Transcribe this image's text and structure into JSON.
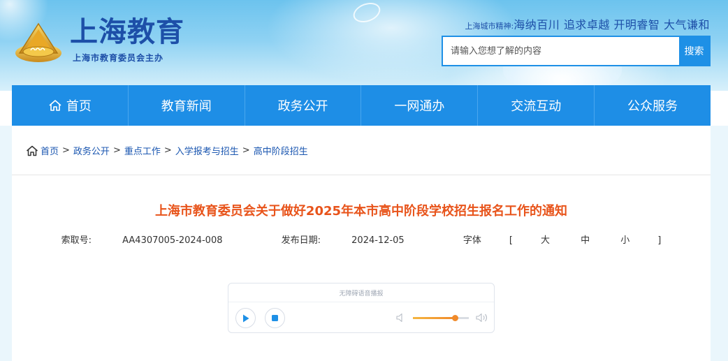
{
  "header": {
    "logo_title": "上海教育",
    "logo_sub": "上海市教育委员会主办",
    "spirit_label": "上海城市精神:",
    "spirit_value": "海纳百川 追求卓越 开明睿智 大气谦和",
    "search": {
      "placeholder": "请输入您想了解的内容",
      "button_label": "搜索"
    }
  },
  "nav": {
    "items": [
      {
        "label": "首页",
        "icon": "home-icon"
      },
      {
        "label": "教育新闻"
      },
      {
        "label": "政务公开"
      },
      {
        "label": "一网通办"
      },
      {
        "label": "交流互动"
      },
      {
        "label": "公众服务"
      }
    ]
  },
  "breadcrumb": {
    "icon": "home-icon",
    "items": [
      "首页",
      "政务公开",
      "重点工作",
      "入学报考与招生",
      "高中阶段招生"
    ],
    "separator": ">"
  },
  "article": {
    "title": "上海市教育委员会关于做好2025年本市高中阶段学校招生报名工作的通知",
    "index_label": "索取号:",
    "index_value": "AA4307005-2024-008",
    "date_label": "发布日期:",
    "date_value": "2024-12-05",
    "font_label": "字体",
    "font_open": "[",
    "font_large": "大",
    "font_medium": "中",
    "font_small": "小",
    "font_close": "]"
  },
  "player": {
    "title": "无障碍语音播报",
    "volume": 0.75
  },
  "colors": {
    "nav_bg": "#1e8ee6",
    "title": "#e8541b",
    "link": "#1a56b0",
    "accent": "#f08a2a"
  }
}
